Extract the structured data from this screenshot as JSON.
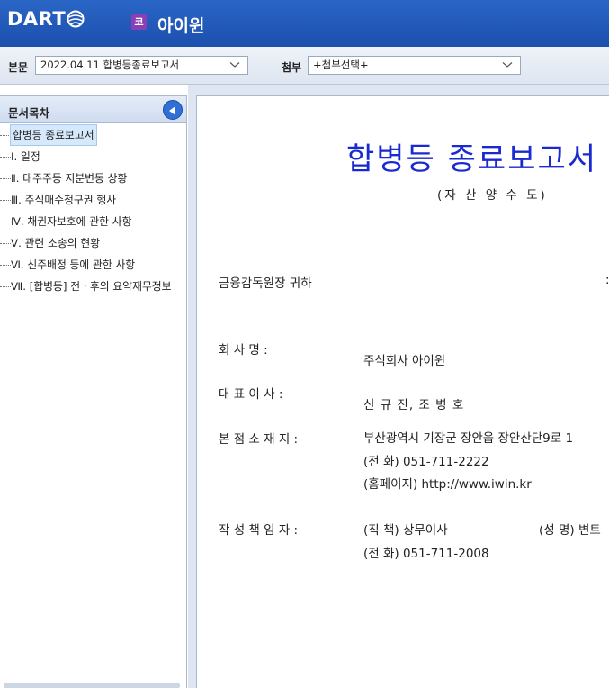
{
  "header": {
    "logo_text": "DART",
    "company_badge": "코",
    "company_name": "아이윈"
  },
  "toolbar": {
    "body_label": "본문",
    "body_select_value": "2022.04.11  합병등종료보고서",
    "attach_label": "첨부",
    "attach_select_value": "+첨부선택+"
  },
  "sidebar": {
    "title": "문서목차",
    "items": [
      {
        "label": "합병등 종료보고서"
      },
      {
        "label": "Ⅰ. 일정"
      },
      {
        "label": "Ⅱ. 대주주등 지분변동 상황"
      },
      {
        "label": "Ⅲ. 주식매수청구권 행사"
      },
      {
        "label": "Ⅳ. 채권자보호에 관한 사항"
      },
      {
        "label": "Ⅴ. 관련 소송의 현황"
      },
      {
        "label": "Ⅵ. 신주배정 등에 관한 사항"
      },
      {
        "label": "Ⅶ. [합병등] 전ㆍ후의 요약재무정보"
      }
    ]
  },
  "document": {
    "title": "합병등 종료보고서",
    "subtitle": "(자 산 양 수 도)",
    "addressee": "금융감독원장 귀하",
    "addressee_right": ":",
    "company_label": "회      사      명 :",
    "company_value": "주식회사 아이윈",
    "ceo_label": "대    표    이    사 :",
    "ceo_value": "신 규 진, 조 병 호",
    "hq_label": "본  점  소  재  지 :",
    "hq_address": "부산광역시 기장군 장안읍 장안산단9로 1",
    "hq_phone": "(전   화) 051-711-2222",
    "hq_homepage": "(홈페이지) http://www.iwin.kr",
    "writer_label": "작  성  책  임  자 :",
    "writer_title": "(직   책)  상무이사",
    "writer_name": "(성   명) 변트",
    "writer_phone": "(전   화) 051-711-2008"
  }
}
